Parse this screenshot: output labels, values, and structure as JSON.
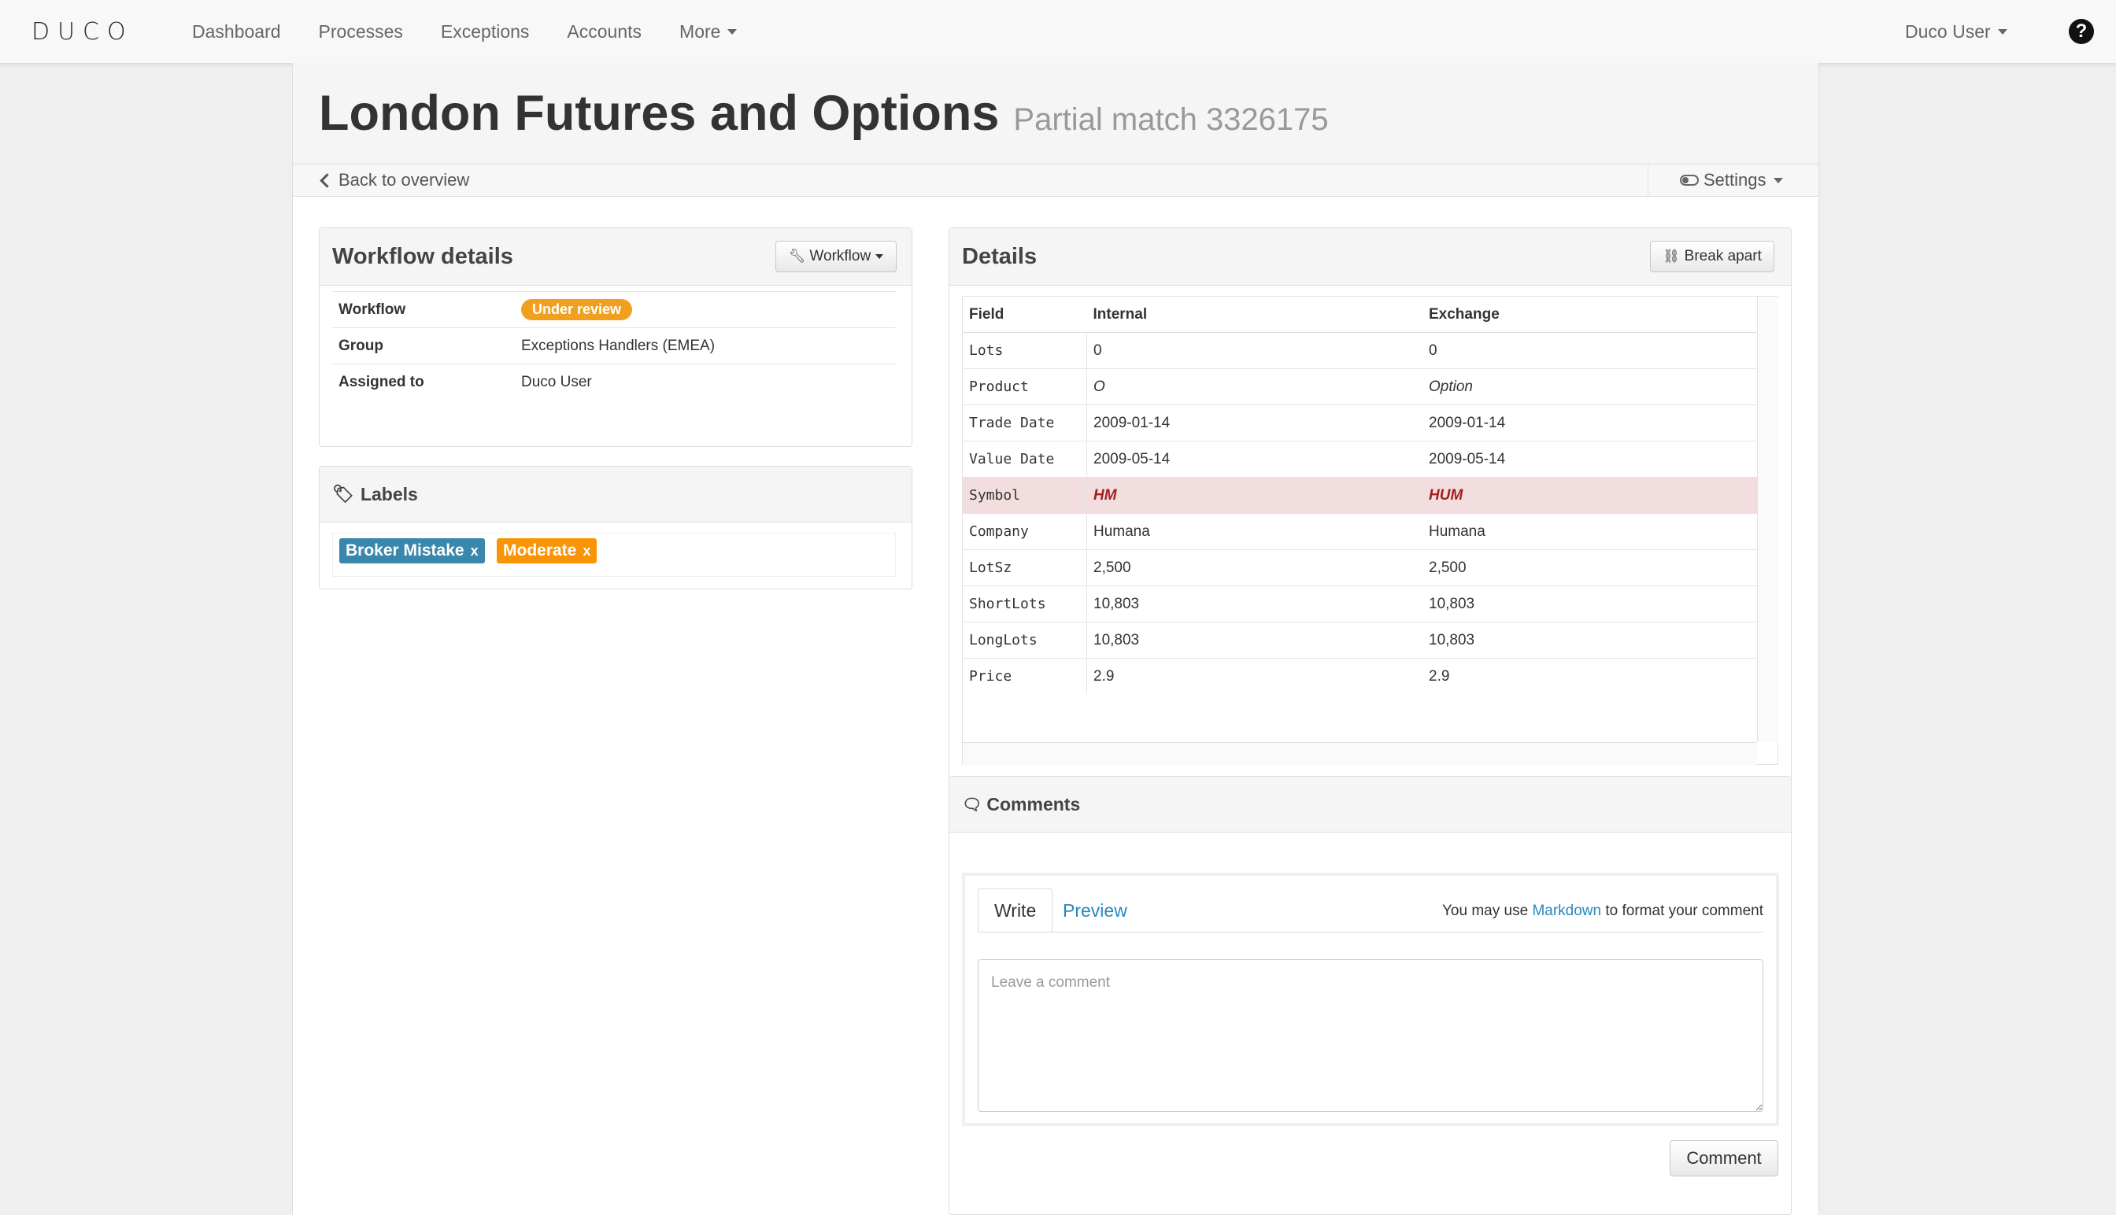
{
  "nav": {
    "logo": "DUCO",
    "links": [
      "Dashboard",
      "Processes",
      "Exceptions",
      "Accounts"
    ],
    "more_label": "More",
    "user_label": "Duco User",
    "help_glyph": "?"
  },
  "page": {
    "title": "London Futures and Options",
    "subtitle": "Partial match 3326175",
    "back_label": "Back to overview",
    "settings_label": "Settings"
  },
  "workflow_panel": {
    "title": "Workflow details",
    "button_label": "Workflow",
    "rows": [
      {
        "key": "Workflow",
        "value": "Under review"
      },
      {
        "key": "Group",
        "value": "Exceptions Handlers (EMEA)"
      },
      {
        "key": "Assigned to",
        "value": "Duco User"
      }
    ],
    "status_color": "#f0a01e"
  },
  "labels_panel": {
    "title": "Labels",
    "labels": [
      {
        "text": "Broker Mistake",
        "color": "#3a87ad"
      },
      {
        "text": "Moderate",
        "color": "#f89406"
      }
    ],
    "remove_glyph": "x"
  },
  "details_panel": {
    "title": "Details",
    "button_label": "Break apart",
    "columns": [
      "Field",
      "Internal",
      "Exchange"
    ],
    "rows": [
      {
        "field": "Lots",
        "internal": "0",
        "exchange": "0"
      },
      {
        "field": "Product",
        "internal": "O",
        "exchange": "Option"
      },
      {
        "field": "Trade Date",
        "internal": "2009-01-14",
        "exchange": "2009-01-14"
      },
      {
        "field": "Value Date",
        "internal": "2009-05-14",
        "exchange": "2009-05-14"
      },
      {
        "field": "Symbol",
        "internal": "HM",
        "exchange": "HUM"
      },
      {
        "field": "Company",
        "internal": "Humana",
        "exchange": "Humana"
      },
      {
        "field": "LotSz",
        "internal": "2,500",
        "exchange": "2,500"
      },
      {
        "field": "ShortLots",
        "internal": "10,803",
        "exchange": "10,803"
      },
      {
        "field": "LongLots",
        "internal": "10,803",
        "exchange": "10,803"
      },
      {
        "field": "Price",
        "internal": "2.9",
        "exchange": "2.9"
      }
    ],
    "mismatch_color": "#f2dede"
  },
  "comments_panel": {
    "title": "Comments",
    "tab_write": "Write",
    "tab_preview": "Preview",
    "hint_prefix": "You may use",
    "hint_link": "Markdown",
    "hint_suffix": "to format your comment",
    "placeholder": "Leave a comment",
    "submit_label": "Comment"
  }
}
